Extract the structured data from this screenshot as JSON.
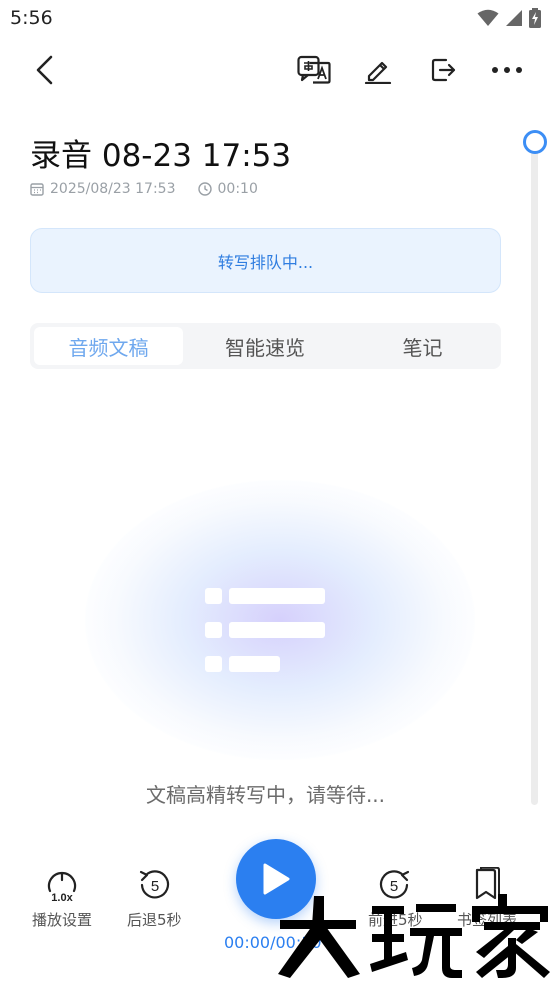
{
  "status_bar": {
    "time": "5:56"
  },
  "title": "录音 08-23 17:53",
  "meta": {
    "datetime": "2025/08/23 17:53",
    "duration": "00:10"
  },
  "queue_status": "转写排队中...",
  "tabs": [
    {
      "label": "音频文稿",
      "active": true
    },
    {
      "label": "智能速览",
      "active": false
    },
    {
      "label": "笔记",
      "active": false
    }
  ],
  "empty_state": {
    "message": "文稿高精转写中，请等待..."
  },
  "player": {
    "speed": "1.0x",
    "speed_label": "播放设置",
    "rewind_seconds": "5",
    "rewind_label": "后退5秒",
    "forward_seconds": "5",
    "forward_label": "前进5秒",
    "bookmark_label": "书签列表",
    "time": "00:00/00:10"
  },
  "colors": {
    "accent": "#2b7ff0",
    "queue_bg": "#eaf3fe",
    "active_tab": "#6fa8ee"
  }
}
